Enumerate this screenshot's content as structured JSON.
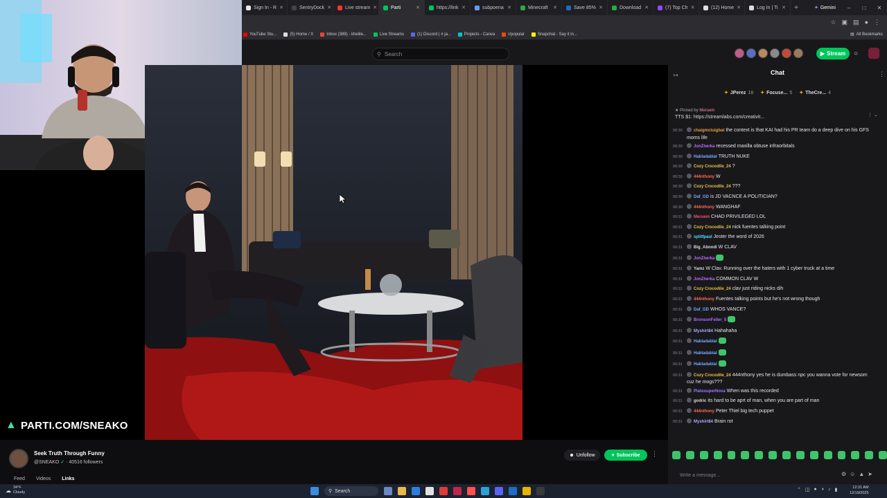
{
  "browser": {
    "tabs": [
      {
        "label": "Sign In - R",
        "color": "#e8e8e8",
        "active": false
      },
      {
        "label": "SentryDock",
        "color": "#444444",
        "active": false
      },
      {
        "label": "Live stream",
        "color": "#ff3333",
        "active": false
      },
      {
        "label": "Parti",
        "color": "#00c55a",
        "active": true
      },
      {
        "label": "https://link",
        "color": "#00c55a",
        "active": false
      },
      {
        "label": "subpoena",
        "color": "#6699ff",
        "active": false
      },
      {
        "label": "Minecraft",
        "color": "#2aa84a",
        "active": false
      },
      {
        "label": "Save 85%",
        "color": "#1b6ec2",
        "active": false
      },
      {
        "label": "Download",
        "color": "#2aa84a",
        "active": false
      },
      {
        "label": "(7) Top Ch",
        "color": "#9146ff",
        "active": false
      },
      {
        "label": "(12) Home",
        "color": "#dddddd",
        "active": false
      },
      {
        "label": "Log In | Ti",
        "color": "#dddddd",
        "active": false
      }
    ],
    "new_tab": "+",
    "gemini": "Gemini",
    "bookmarks": [
      {
        "label": "YouTube Stu...",
        "color": "#ff0000"
      },
      {
        "label": "(5) Home / X",
        "color": "#dddddd"
      },
      {
        "label": "Inbox (389) - khelile...",
        "color": "#ea4335"
      },
      {
        "label": "Live Streams",
        "color": "#00c55a"
      },
      {
        "label": "(1) Discord | #  ja...",
        "color": "#5865f2"
      },
      {
        "label": "Projects - Canva",
        "color": "#00c4cc"
      },
      {
        "label": "r/popular",
        "color": "#ff4500"
      },
      {
        "label": "Snapchat - Say it in...",
        "color": "#fffc00"
      }
    ],
    "all_bookmarks": "All Bookmarks"
  },
  "header": {
    "search_placeholder": "Search",
    "stream_button": "Stream"
  },
  "overlay": {
    "site_text": "PARTI.COM/SNEAKO"
  },
  "channel": {
    "title": "Seek Truth Through Funny",
    "handle": "@SNEAKO",
    "followers": "40516",
    "followers_label": "followers",
    "nav": [
      "Feed",
      "Videos",
      "Links"
    ],
    "unfollow": "Unfollow",
    "subscribe": "Subscribe"
  },
  "chat": {
    "title": "Chat",
    "leaderboard": [
      {
        "name": "JPerez",
        "count": "18"
      },
      {
        "name": "Focuse...",
        "count": "5"
      },
      {
        "name": "TheCre...",
        "count": "4"
      }
    ],
    "pinned_by_label": "Pinned by",
    "pinned_by": "Meruem",
    "pinned_text": "TTS $1: https://streamlabs.com/creativit...",
    "messages": [
      {
        "t": "00:30",
        "user": "chaigmctuigbat",
        "color": "#e0a040",
        "text": "the context is that KAI had his PR team do a deep dive on his GFS",
        "text2": "moms life"
      },
      {
        "t": "00:30",
        "user": "JonZherka",
        "color": "#c26bff",
        "text": "recessed maxilla obtuse infraorbitals"
      },
      {
        "t": "00:30",
        "user": "Habladablal",
        "color": "#7aa8ff",
        "text": "TRUTH NUKE"
      },
      {
        "t": "00:30",
        "user": "Cozy Crocodile_24",
        "color": "#e6c24a",
        "text": "?"
      },
      {
        "t": "00:30",
        "user": "444nthony",
        "color": "#ff6a4d",
        "text": "W"
      },
      {
        "t": "00:30",
        "user": "Cozy Crocodile_24",
        "color": "#e6c24a",
        "text": "???"
      },
      {
        "t": "00:30",
        "user": "Daf_GD",
        "color": "#7aa8ff",
        "text": "is JD VACNCE A POLITICIAN?"
      },
      {
        "t": "00:30",
        "user": "444nthony",
        "color": "#ff6a4d",
        "text": "WANGHAF"
      },
      {
        "t": "00:31",
        "user": "Meruem",
        "color": "#ff4d6a",
        "text": "CHAD PRIVILEGED LOL"
      },
      {
        "t": "00:31",
        "user": "Cozy Crocodile_24",
        "color": "#e6c24a",
        "text": "nick fuentes talking point"
      },
      {
        "t": "00:31",
        "user": "splitfpaul",
        "color": "#4de0ff",
        "text": "Jester the word of 2026"
      },
      {
        "t": "00:31",
        "user": "Big_Aboodi",
        "color": "#dddddd",
        "text": "W CLAV"
      },
      {
        "t": "00:31",
        "user": "JonZherka",
        "color": "#c26bff",
        "text": "",
        "emote": true
      },
      {
        "t": "00:31",
        "user": "Yamz",
        "color": "#dddddd",
        "text": "W Clav. Running over the haters with 1 cyber truck at a time"
      },
      {
        "t": "00:31",
        "user": "JonZherka",
        "color": "#c26bff",
        "text": "COMMON CLAV W"
      },
      {
        "t": "00:31",
        "user": "Cozy Crocodile_24",
        "color": "#e6c24a",
        "text": "clav just riding nicks dih"
      },
      {
        "t": "00:31",
        "user": "444nthony",
        "color": "#ff6a4d",
        "text": "Fuentes talking points but he's not wrong though"
      },
      {
        "t": "00:31",
        "user": "Daf_GD",
        "color": "#7aa8ff",
        "text": "WHOS VANCE?"
      },
      {
        "t": "00:31",
        "user": "BronsonFeller_5",
        "color": "#a96bff",
        "text": "",
        "emote": true
      },
      {
        "t": "00:31",
        "user": "Myshirt84",
        "color": "#a9a9ff",
        "text": "Hahahaha"
      },
      {
        "t": "00:31",
        "user": "Habladablal",
        "color": "#7aa8ff",
        "text": "",
        "emote": true
      },
      {
        "t": "00:31",
        "user": "Habladablal",
        "color": "#7aa8ff",
        "text": "",
        "emote": true
      },
      {
        "t": "00:31",
        "user": "Habladablal",
        "color": "#7aa8ff",
        "text": "",
        "emote": true
      },
      {
        "t": "00:31",
        "user": "Cozy Crocodile_24",
        "color": "#e6c24a",
        "text": "444nthony yes he is dumbass npc you wanna vote for newsom",
        "text2": "cuz he mogs???"
      },
      {
        "t": "00:31",
        "user": "PlatosuperNova",
        "color": "#9f7aff",
        "text": "When was this recorded"
      },
      {
        "t": "00:31",
        "user": "godric",
        "color": "#dddddd",
        "text": "its hard to be aprt of man, when you are part of man"
      },
      {
        "t": "00:31",
        "user": "444nthony",
        "color": "#ff6a4d",
        "text": "Peter Thiel big tech puppet"
      },
      {
        "t": "00:31",
        "user": "Myshirt84",
        "color": "#a9a9ff",
        "text": "Brain rot"
      }
    ],
    "input_placeholder": "Write a message..."
  },
  "taskbar": {
    "weather_temp": "34°F",
    "weather_desc": "Cloudy",
    "search": "Search",
    "time": "12:31 AM",
    "date": "12/19/2025"
  }
}
